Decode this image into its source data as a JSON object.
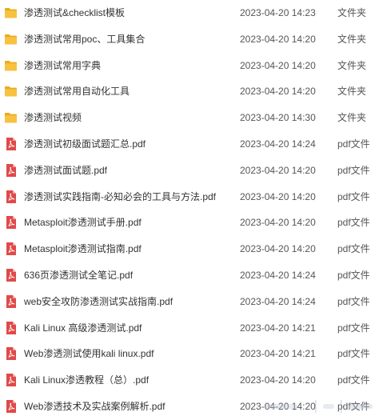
{
  "files": [
    {
      "name": "渗透测试&checklist模板",
      "date": "2023-04-20 14:23",
      "type": "文件夹",
      "icon": "folder-icon"
    },
    {
      "name": "渗透测试常用poc、工具集合",
      "date": "2023-04-20 14:20",
      "type": "文件夹",
      "icon": "folder-icon"
    },
    {
      "name": "渗透测试常用字典",
      "date": "2023-04-20 14:20",
      "type": "文件夹",
      "icon": "folder-icon"
    },
    {
      "name": "渗透测试常用自动化工具",
      "date": "2023-04-20 14:20",
      "type": "文件夹",
      "icon": "folder-icon"
    },
    {
      "name": "渗透测试视频",
      "date": "2023-04-20 14:30",
      "type": "文件夹",
      "icon": "folder-icon"
    },
    {
      "name": "渗透测试初级面试题汇总.pdf",
      "date": "2023-04-20 14:24",
      "type": "pdf文件",
      "icon": "pdf-icon"
    },
    {
      "name": "渗透测试面试题.pdf",
      "date": "2023-04-20 14:20",
      "type": "pdf文件",
      "icon": "pdf-icon"
    },
    {
      "name": "渗透测试实践指南-必知必会的工具与方法.pdf",
      "date": "2023-04-20 14:20",
      "type": "pdf文件",
      "icon": "pdf-icon"
    },
    {
      "name": "Metasploit渗透测试手册.pdf",
      "date": "2023-04-20 14:20",
      "type": "pdf文件",
      "icon": "pdf-icon"
    },
    {
      "name": "Metasploit渗透测试指南.pdf",
      "date": "2023-04-20 14:20",
      "type": "pdf文件",
      "icon": "pdf-icon"
    },
    {
      "name": "636页渗透测试全笔记.pdf",
      "date": "2023-04-20 14:24",
      "type": "pdf文件",
      "icon": "pdf-icon"
    },
    {
      "name": "web安全攻防渗透测试实战指南.pdf",
      "date": "2023-04-20 14:24",
      "type": "pdf文件",
      "icon": "pdf-icon"
    },
    {
      "name": "Kali Linux 高级渗透测试.pdf",
      "date": "2023-04-20 14:21",
      "type": "pdf文件",
      "icon": "pdf-icon"
    },
    {
      "name": "Web渗透测试使用kali linux.pdf",
      "date": "2023-04-20 14:21",
      "type": "pdf文件",
      "icon": "pdf-icon"
    },
    {
      "name": "Kali Linux渗透教程（总）.pdf",
      "date": "2023-04-20 14:20",
      "type": "pdf文件",
      "icon": "pdf-icon"
    },
    {
      "name": "Web渗透技术及实战案例解析.pdf",
      "date": "2023-04-20 14:20",
      "type": "pdf文件",
      "icon": "pdf-icon"
    }
  ],
  "colors": {
    "folder": "#f7c240",
    "folder_dark": "#e9ab1c",
    "pdf": "#e04a4a"
  }
}
